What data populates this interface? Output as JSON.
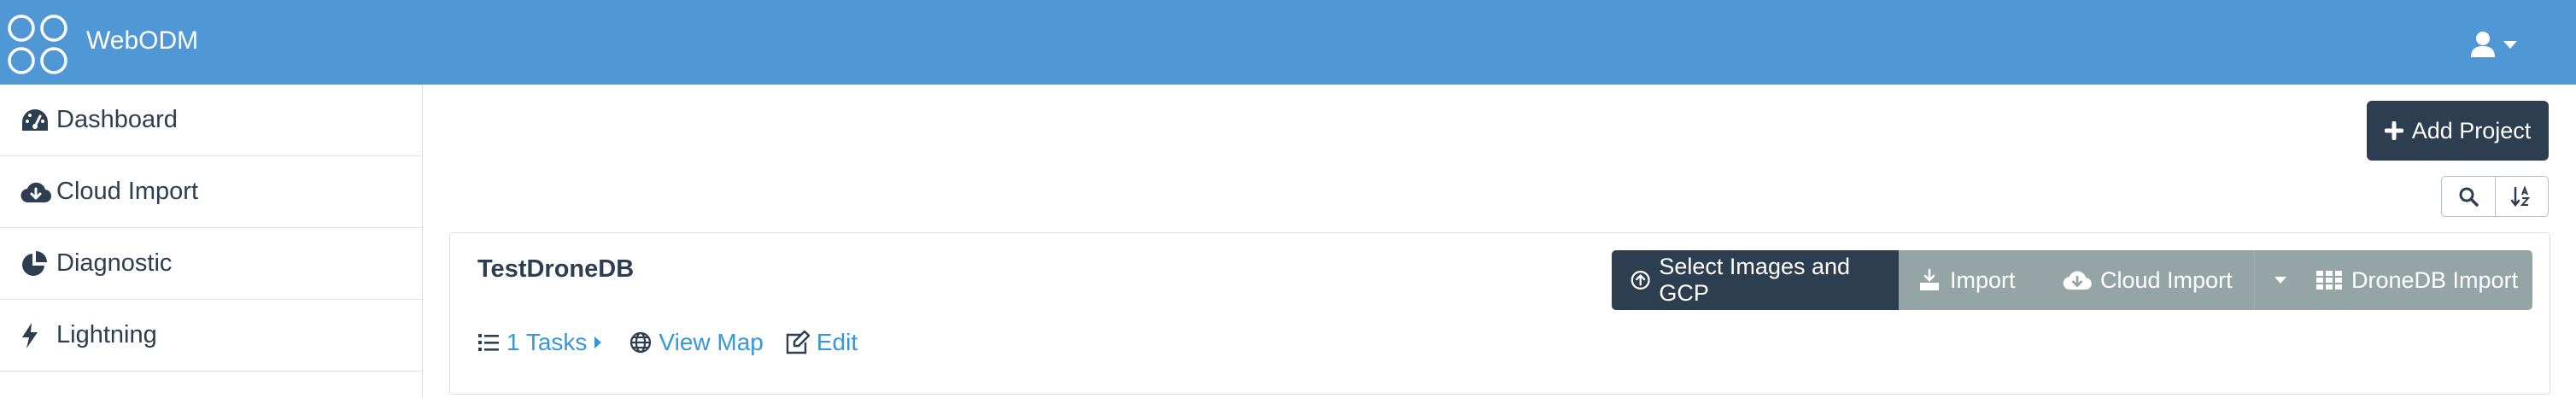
{
  "colors": {
    "brand": "#5097d6",
    "dark": "#2c3e50",
    "grey": "#95a5a6",
    "link": "#3498db"
  },
  "header": {
    "app_name": "WebODM",
    "logo_icon": "webodm-logo-icon",
    "user_icon": "user-icon",
    "caret_icon": "caret-down-icon"
  },
  "sidebar": {
    "items": [
      {
        "label": "Dashboard",
        "icon": "speedometer-icon"
      },
      {
        "label": "Cloud Import",
        "icon": "cloud-download-icon"
      },
      {
        "label": "Diagnostic",
        "icon": "pie-chart-icon"
      },
      {
        "label": "Lightning",
        "icon": "bolt-icon"
      }
    ]
  },
  "toolbar": {
    "add_project_label": "Add Project",
    "add_icon": "plus-icon",
    "search_icon": "search-icon",
    "sort_icon": "sort-alpha-icon"
  },
  "project": {
    "name": "TestDroneDB",
    "tasks_label": "1 Tasks",
    "view_map_label": "View Map",
    "edit_label": "Edit",
    "buttons": {
      "select_images": "Select Images and GCP",
      "import": "Import",
      "cloud_import": "Cloud Import",
      "dronedb_import": "DroneDB Import"
    }
  }
}
